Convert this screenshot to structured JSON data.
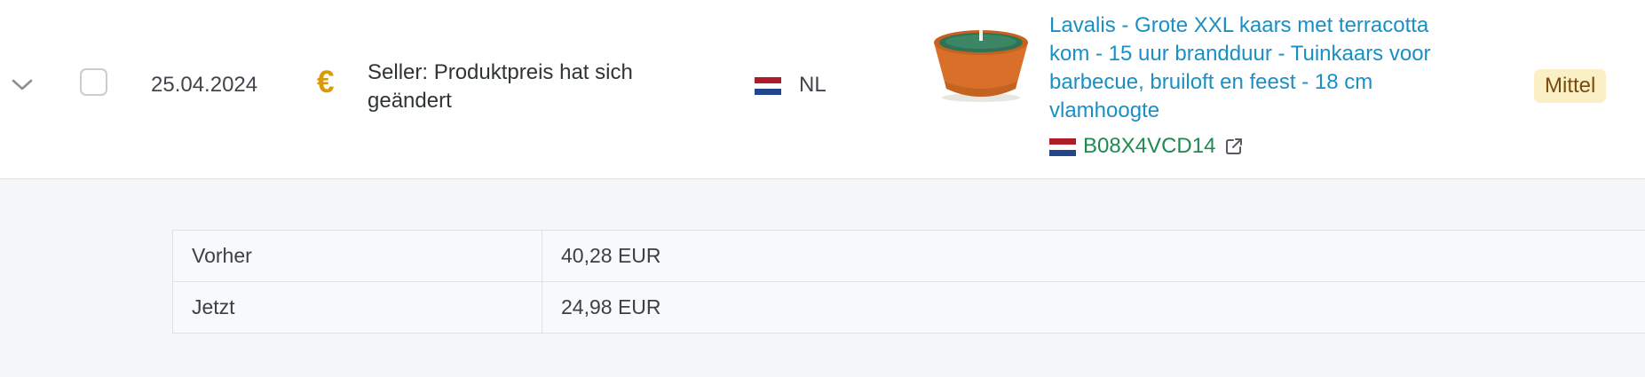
{
  "row": {
    "date": "25.04.2024",
    "event_icon": "euro-icon",
    "event_icon_glyph": "€",
    "event_text": "Seller: Produktpreis hat sich geändert",
    "marketplace": "NL",
    "marketplace_flag": "netherlands-flag-icon",
    "product": {
      "title": "Lavalis - Grote XXL kaars met terracotta kom - 15 uur brandduur - Tuinkaars voor barbecue, bruiloft en feest - 18 cm vlamhoogte",
      "asin": "B08X4VCD14",
      "image": "candle-terracotta-bowl"
    },
    "priority": "Mittel"
  },
  "details": {
    "rows": [
      {
        "label": "Vorher",
        "value": "40,28 EUR"
      },
      {
        "label": "Jetzt",
        "value": "24,98 EUR"
      }
    ]
  },
  "colors": {
    "link": "#1a8fc4",
    "asin": "#1e8a4f",
    "euro": "#d99a08",
    "badge_bg": "#fbefc6",
    "badge_text": "#7a4b0a"
  }
}
